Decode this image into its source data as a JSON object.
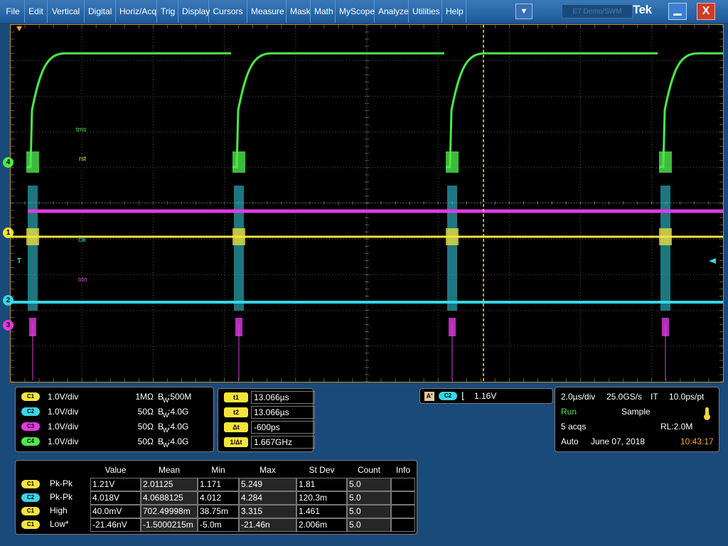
{
  "menu": [
    "File",
    "Edit",
    "Vertical",
    "Digital",
    "Horiz/Acq",
    "Trig",
    "Display",
    "Cursors",
    "Measure",
    "Mask",
    "Math",
    "MyScope",
    "Analyze",
    "Utilities",
    "Help"
  ],
  "window": {
    "brand": "Tek",
    "dim_text": "E7 Demo/SWM",
    "dropdown_glyph": "▼",
    "close_glyph": "X"
  },
  "channel_markers": [
    "4",
    "1",
    "2",
    "3"
  ],
  "wave_labels": {
    "tms": "tms",
    "rst": "rst",
    "clk": "clk",
    "tdo": "tdo"
  },
  "trigger_marker": "T",
  "colors": {
    "c1": "#f4e43a",
    "c2": "#35d7e7",
    "c3": "#e23ae2",
    "c4": "#4ce84a",
    "border": "#c68a23"
  },
  "channels": [
    {
      "chip": "C1",
      "scale": "1.0V/div",
      "coupling": "1MΩ",
      "bw_label": "B",
      "bw_sub": "W",
      "bw_value": ":500M"
    },
    {
      "chip": "C2",
      "scale": "1.0V/div",
      "coupling": "50Ω",
      "bw_label": "B",
      "bw_sub": "W",
      "bw_value": ":4.0G"
    },
    {
      "chip": "C3",
      "scale": "1.0V/div",
      "coupling": "50Ω",
      "bw_label": "B",
      "bw_sub": "W",
      "bw_value": ":4.0G"
    },
    {
      "chip": "C4",
      "scale": "1.0V/div",
      "coupling": "50Ω",
      "bw_label": "B",
      "bw_sub": "W",
      "bw_value": ":4.0G"
    }
  ],
  "cursors": [
    {
      "tag": "t1",
      "value": "13.066µs"
    },
    {
      "tag": "t2",
      "value": "13.066µs"
    },
    {
      "tag": "Δt",
      "value": "-600ps"
    },
    {
      "tag": "1/Δt",
      "value": "1.667GHz"
    }
  ],
  "trigger": {
    "mode_tag": "A'",
    "source": "C2",
    "slope_glyph": "⌊",
    "level": "1.16V"
  },
  "timebase": {
    "time_div": "2.0µs/div",
    "sample_rate": "25.0GS/s",
    "mode": "IT",
    "resolution": "10.0ps/pt",
    "status": "Run",
    "acq_mode": "Sample",
    "acqs": "5 acqs",
    "record_length": "RL:2.0M",
    "trigger_mode": "Auto",
    "date": "June 07, 2018",
    "time": "10:43:17"
  },
  "measurements": {
    "headers": [
      "Value",
      "Mean",
      "Min",
      "Max",
      "St Dev",
      "Count",
      "Info"
    ],
    "rows": [
      {
        "chip": "C1",
        "chip_class": "c1",
        "name": "Pk-Pk",
        "cells": [
          "1.21V",
          "2.01125",
          "1.171",
          "5.249",
          "1.81",
          "5.0",
          ""
        ]
      },
      {
        "chip": "C2",
        "chip_class": "c2",
        "name": "Pk-Pk",
        "cells": [
          "4.018V",
          "4.0688125",
          "4.012",
          "4.284",
          "120.3m",
          "5.0",
          ""
        ]
      },
      {
        "chip": "C1",
        "chip_class": "c1",
        "name": "High",
        "cells": [
          "40.0mV",
          "702.49998m",
          "38.75m",
          "3.315",
          "1.461",
          "5.0",
          ""
        ]
      },
      {
        "chip": "C1",
        "chip_class": "c1",
        "name": "Low*",
        "cells": [
          "-21.46nV",
          "-1.5000215m",
          "-5.0m",
          "-21.46n",
          "2.006m",
          "5.0",
          ""
        ]
      }
    ]
  }
}
